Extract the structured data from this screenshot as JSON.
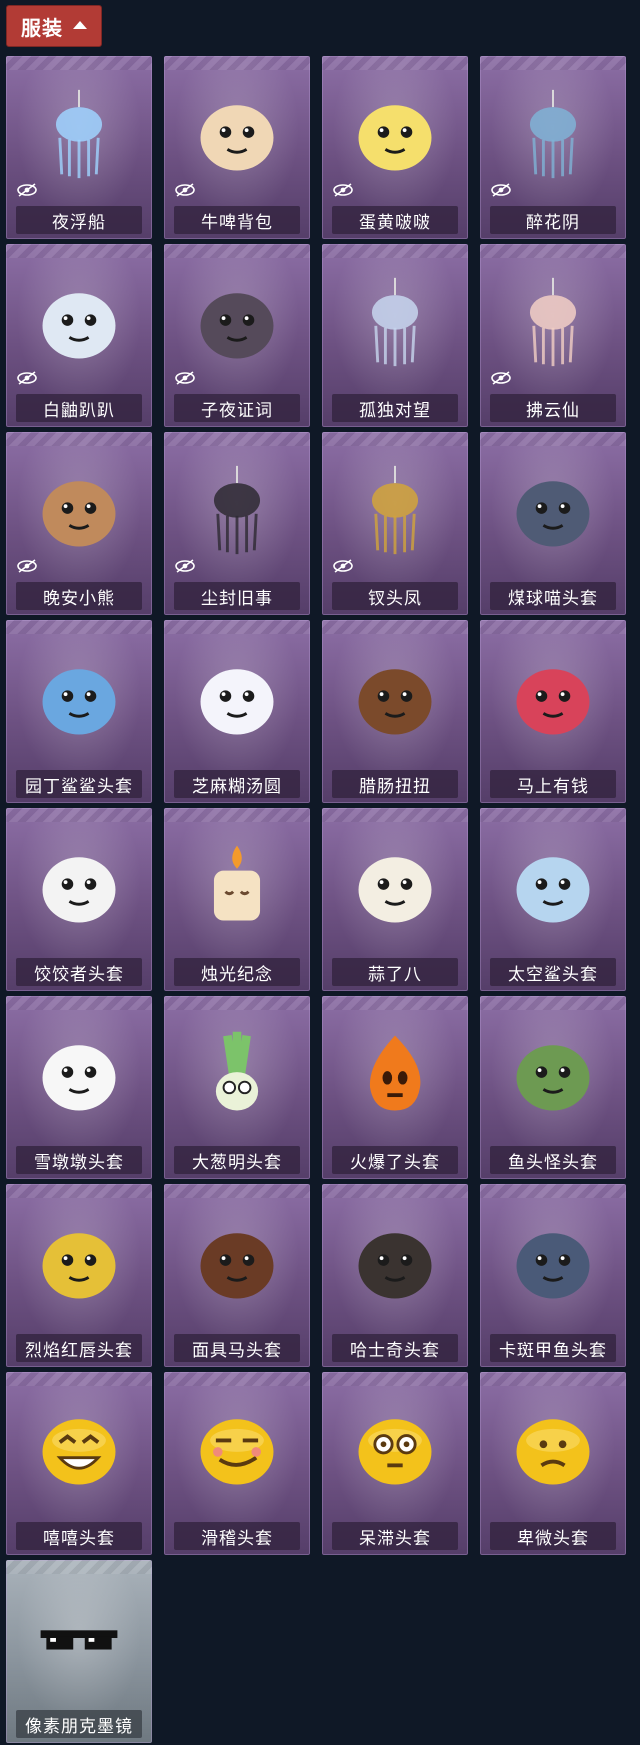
{
  "header": {
    "label": "服装",
    "chevron_icon": "chevron-up-icon"
  },
  "items": [
    {
      "name": "夜浮船",
      "hidden": true,
      "icon": "jellyfish",
      "tint": "#9fd4ff"
    },
    {
      "name": "牛啤背包",
      "hidden": true,
      "icon": "cow-barrel",
      "tint": "#f0d7b5"
    },
    {
      "name": "蛋黄啵啵",
      "hidden": true,
      "icon": "chick-egg",
      "tint": "#f5df6c"
    },
    {
      "name": "醉花阴",
      "hidden": true,
      "icon": "ornament",
      "tint": "#7fb3d6"
    },
    {
      "name": "白鼬趴趴",
      "hidden": true,
      "icon": "ferret",
      "tint": "#dfe8f3"
    },
    {
      "name": "子夜证词",
      "hidden": true,
      "icon": "owl",
      "tint": "#554a5a"
    },
    {
      "name": "孤独对望",
      "hidden": false,
      "icon": "doll",
      "tint": "#c7d6ee"
    },
    {
      "name": "拂云仙",
      "hidden": true,
      "icon": "fairy",
      "tint": "#f2cfc5"
    },
    {
      "name": "晚安小熊",
      "hidden": true,
      "icon": "bear",
      "tint": "#c08a5c"
    },
    {
      "name": "尘封旧事",
      "hidden": true,
      "icon": "doll-dark",
      "tint": "#2e2a33"
    },
    {
      "name": "钗头凤",
      "hidden": true,
      "icon": "phoenix-crown",
      "tint": "#d2a43a"
    },
    {
      "name": "煤球喵头套",
      "hidden": false,
      "icon": "cat-head",
      "tint": "#4f5b75"
    },
    {
      "name": "园丁鲨鲨头套",
      "hidden": false,
      "icon": "shark-bee",
      "tint": "#6aa7e0"
    },
    {
      "name": "芝麻糊汤圆",
      "hidden": false,
      "icon": "dumpling",
      "tint": "#f4f4fb"
    },
    {
      "name": "腊肠扭扭",
      "hidden": false,
      "icon": "dog",
      "tint": "#7b4a2b"
    },
    {
      "name": "马上有钱",
      "hidden": false,
      "icon": "horse-red",
      "tint": "#d8435a"
    },
    {
      "name": "饺饺者头套",
      "hidden": false,
      "icon": "cloud",
      "tint": "#f3f3f3"
    },
    {
      "name": "烛光纪念",
      "hidden": false,
      "icon": "candle",
      "tint": "#f5e2c3"
    },
    {
      "name": "蒜了八",
      "hidden": false,
      "icon": "garlic",
      "tint": "#f3eee2"
    },
    {
      "name": "太空鲨头套",
      "hidden": false,
      "icon": "shark",
      "tint": "#b6d5ef"
    },
    {
      "name": "雪墩墩头套",
      "hidden": false,
      "icon": "snowman",
      "tint": "#f7f7f7"
    },
    {
      "name": "大葱明头套",
      "hidden": false,
      "icon": "scallion",
      "tint": "#7cc36a"
    },
    {
      "name": "火爆了头套",
      "hidden": false,
      "icon": "fire",
      "tint": "#f07a1c"
    },
    {
      "name": "鱼头怪头套",
      "hidden": false,
      "icon": "fish-head",
      "tint": "#6d9a52"
    },
    {
      "name": "烈焰红唇头套",
      "hidden": false,
      "icon": "pika",
      "tint": "#e5c037"
    },
    {
      "name": "面具马头套",
      "hidden": false,
      "icon": "horse",
      "tint": "#6a3b25"
    },
    {
      "name": "哈士奇头套",
      "hidden": false,
      "icon": "husky",
      "tint": "#3a3330"
    },
    {
      "name": "卡斑甲鱼头套",
      "hidden": false,
      "icon": "whale",
      "tint": "#4a5a78"
    },
    {
      "name": "嘻嘻头套",
      "hidden": false,
      "icon": "emoji-grin",
      "tint": "#f3c21b"
    },
    {
      "name": "滑稽头套",
      "hidden": false,
      "icon": "emoji-smirk",
      "tint": "#f3c21b"
    },
    {
      "name": "呆滞头套",
      "hidden": false,
      "icon": "emoji-stare",
      "tint": "#f3c21b"
    },
    {
      "name": "卑微头套",
      "hidden": false,
      "icon": "emoji-meek",
      "tint": "#f3c21b"
    },
    {
      "name": "像素朋克墨镜",
      "hidden": false,
      "icon": "pixel-glasses",
      "tint": "#111111",
      "rarity": "gray"
    }
  ]
}
